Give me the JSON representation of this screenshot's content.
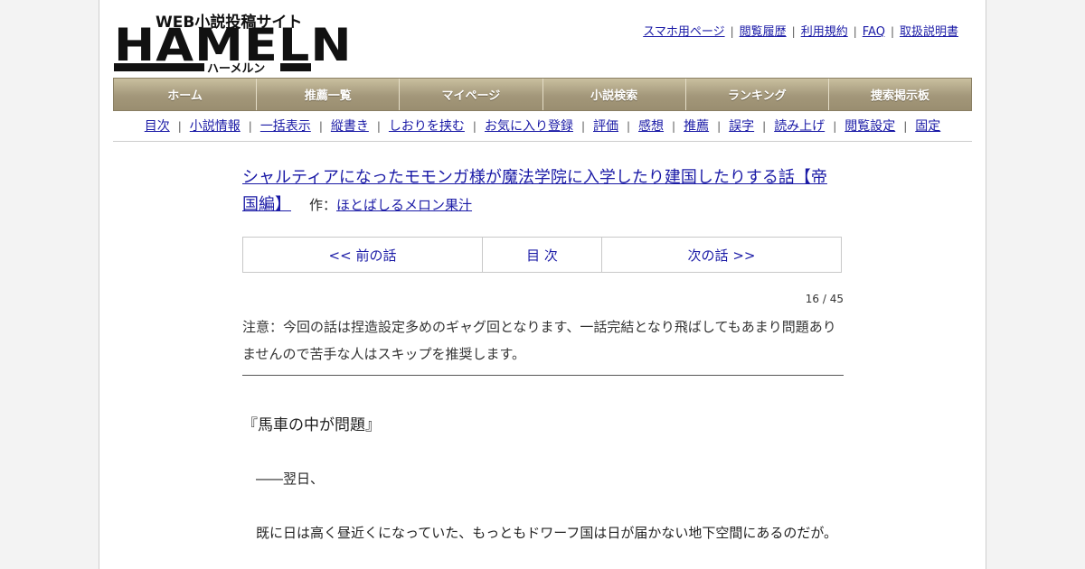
{
  "logo": {
    "tagline": "WEB小説投稿サイト",
    "wordmark": "HAMELN",
    "kana": "ハーメルン"
  },
  "top_links": [
    "スマホ用ページ",
    "閲覧履歴",
    "利用規約",
    "FAQ",
    "取扱説明書"
  ],
  "nav": [
    "ホーム",
    "推薦一覧",
    "マイページ",
    "小説検索",
    "ランキング",
    "捜索掲示板"
  ],
  "subnav": [
    "目次",
    "小説情報",
    "一括表示",
    "縦書き",
    "しおりを挟む",
    "お気に入り登録",
    "評価",
    "感想",
    "推薦",
    "誤字",
    "読み上げ",
    "閲覧設定",
    "固定"
  ],
  "novel": {
    "title": "シャルティアになったモモンガ様が魔法学院に入学したり建国したりする話【帝国編】",
    "author_prefix": "作：",
    "author": "ほとばしるメロン果汁"
  },
  "pager": {
    "prev": "<< 前の話",
    "toc": "目 次",
    "next": "次の話 >>"
  },
  "page_count": "16 / 45",
  "notice": "注意：今回の話は捏造設定多めのギャグ回となります、一話完結となり飛ばしてもあまり問題ありませんので苦手な人はスキップを推奨します。",
  "chapter_title": "『馬車の中が問題』",
  "paragraphs": [
    "――翌日、",
    "既に日は高く昼近くになっていた、もっともドワーフ国は日が届かない地下空間にあるのだが。"
  ]
}
